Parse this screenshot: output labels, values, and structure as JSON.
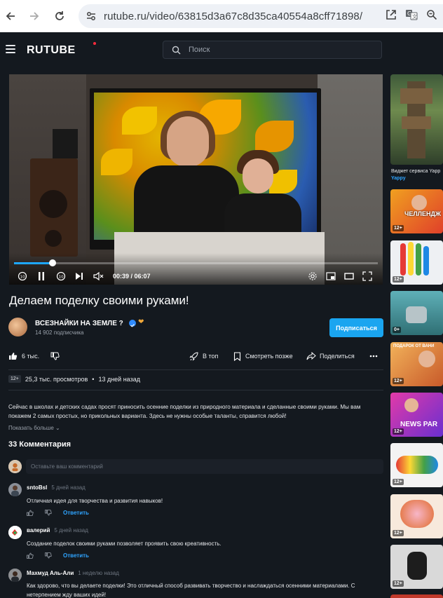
{
  "browser": {
    "url": "rutube.ru/video/63815d3a67c8d35ca40554a8cff71898/"
  },
  "header": {
    "logo": "RUTUBE",
    "search_placeholder": "Поиск"
  },
  "player": {
    "current_time": "00:39",
    "duration": "06:07",
    "timecode": "00:39 / 06:07",
    "progress_fraction": 0.106
  },
  "video": {
    "title": "Делаем поделку своими руками!"
  },
  "channel": {
    "name": "ВСЕЗНАЙКИ НА ЗЕМЛЕ ?",
    "subscribers": "14 902 подписчика",
    "subscribe_label": "Подписаться"
  },
  "actions": {
    "likes": "6 тыс.",
    "to_top": "В топ",
    "watch_later": "Смотреть позже",
    "share": "Поделиться"
  },
  "meta": {
    "age": "12+",
    "views": "25,3 тыс. просмотров",
    "posted": "13 дней назад"
  },
  "description": {
    "text": "Сейчас в школах и детских садах просят приносить осенние поделки из природного материала и сделанные своими руками. Мы вам покажем 2 самых простых, но прикольных варианта. Здесь не нужны особые таланты, справится любой!",
    "show_more": "Показать больше"
  },
  "comments": {
    "count_label": "33 Комментария",
    "input_placeholder": "Оставьте ваш комментарий",
    "reply_label": "Ответить",
    "items": [
      {
        "author": "sntoBsl",
        "time": "5 дней назад",
        "text": "Отличная идея для творчества и развития навыков!"
      },
      {
        "author": "валерий",
        "time": "5 дней назад",
        "text": "Создание поделок своими руками позволяет проявить свою креативность."
      },
      {
        "author": "Махмуд Аль-Али",
        "time": "1 неделю назад",
        "text": "Как здорово, что вы делаете поделки! Это отличный способ развивать творчество и наслаждаться осенними материалами. С нетерпением жду ваших идей!"
      }
    ]
  },
  "sidebar": {
    "first_caption": "Виджет сервиса Yapp",
    "first_caption_sub": "Yappy",
    "items": [
      {
        "badge": "",
        "overlay": ""
      },
      {
        "badge": "12+",
        "overlay": "ЧЕЛЛЕНДЖ"
      },
      {
        "badge": "12+",
        "overlay": ""
      },
      {
        "badge": "0+",
        "overlay": ""
      },
      {
        "badge": "12+",
        "overlay": "ПОДАРОК ОТ ВАНИ"
      },
      {
        "badge": "12+",
        "overlay": "NEWS PAR"
      },
      {
        "badge": "12+",
        "overlay": ""
      },
      {
        "badge": "12+",
        "overlay": ""
      },
      {
        "badge": "12+",
        "overlay": ""
      }
    ]
  },
  "colors": {
    "background": "#14191f",
    "accent": "#1aa5f0",
    "brand_dot": "#ff2b3d",
    "progress": "#1ea7ff"
  }
}
